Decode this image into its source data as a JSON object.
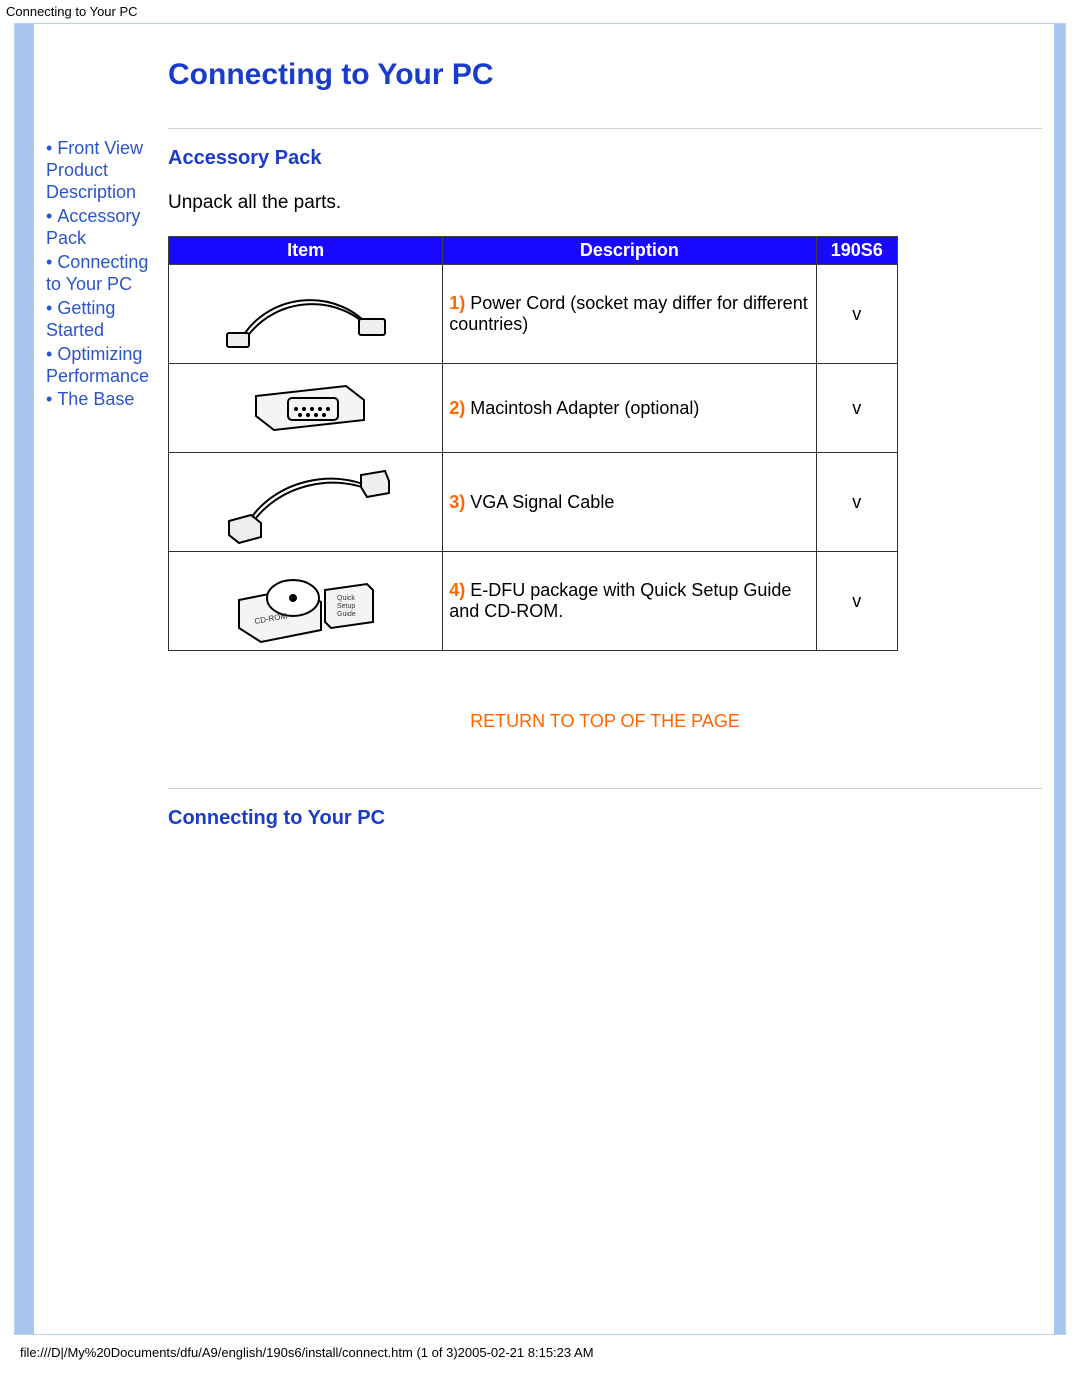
{
  "header": {
    "page_title_small": "Connecting to Your PC"
  },
  "sidebar": {
    "items": [
      {
        "label": "Front View Product Description"
      },
      {
        "label": "Accessory Pack"
      },
      {
        "label": "Connecting to Your PC"
      },
      {
        "label": "Getting Started"
      },
      {
        "label": "Optimizing Performance"
      },
      {
        "label": "The Base"
      }
    ]
  },
  "main": {
    "title": "Connecting to Your PC",
    "sections": {
      "accessory": {
        "heading": "Accessory Pack",
        "intro": "Unpack all the parts.",
        "table": {
          "headers": {
            "item": "Item",
            "description": "Description",
            "model": "190S6"
          },
          "rows": [
            {
              "num": "1)",
              "desc": " Power Cord (socket may differ for different countries)",
              "mark": "v"
            },
            {
              "num": "2)",
              "desc": " Macintosh Adapter (optional)",
              "mark": "v"
            },
            {
              "num": "3)",
              "desc": " VGA Signal Cable",
              "mark": "v"
            },
            {
              "num": "4)",
              "desc": " E-DFU package with Quick Setup Guide and CD-ROM.",
              "mark": "v"
            }
          ]
        }
      },
      "return_link": "RETURN TO TOP OF THE PAGE",
      "connecting": {
        "heading": "Connecting to Your PC"
      }
    }
  },
  "footer": {
    "path": "file:///D|/My%20Documents/dfu/A9/english/190s6/install/connect.htm (1 of 3)2005-02-21 8:15:23 AM"
  }
}
